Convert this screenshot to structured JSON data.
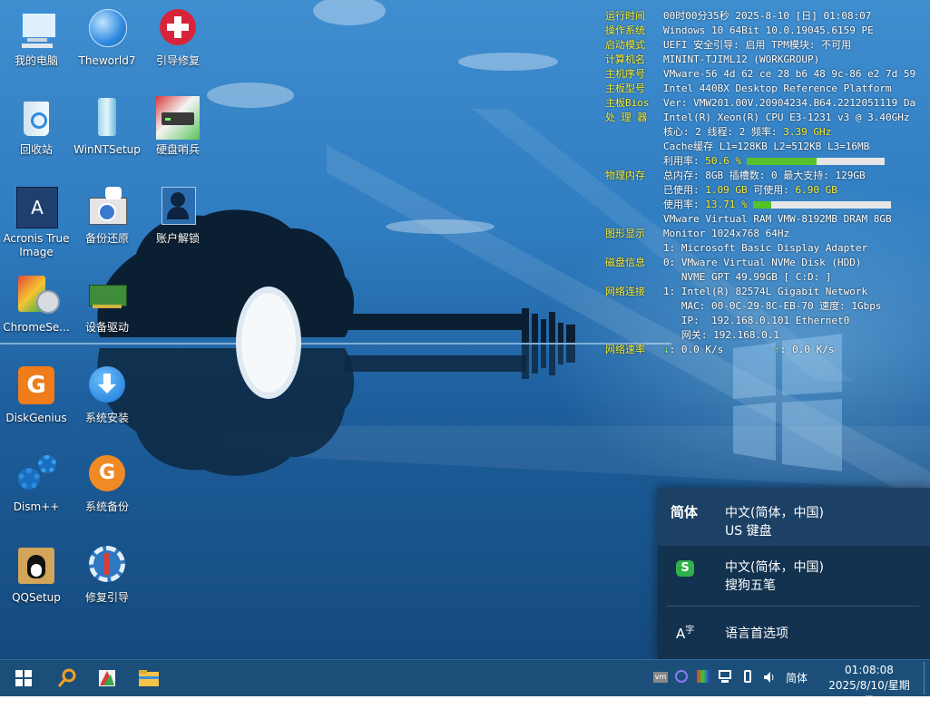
{
  "desktop_icons": [
    {
      "label": "我的电脑",
      "icon": "computer-icon"
    },
    {
      "label": "Theworld7",
      "icon": "globe-icon"
    },
    {
      "label": "引导修复",
      "icon": "plus-repair-icon"
    },
    {
      "label": "回收站",
      "icon": "recycle-bin-icon"
    },
    {
      "label": "WinNTSetup",
      "icon": "setup-icon"
    },
    {
      "label": "硬盘哨兵",
      "icon": "harddisk-icon"
    },
    {
      "label": "Acronis True Image",
      "icon": "acronis-icon"
    },
    {
      "label": "备份还原",
      "icon": "backup-icon"
    },
    {
      "label": "账户解锁",
      "icon": "account-icon"
    },
    {
      "label": "ChromeSe...",
      "icon": "chrome-setup-icon"
    },
    {
      "label": "设备驱动",
      "icon": "device-driver-icon"
    },
    {
      "label": "DiskGenius",
      "icon": "diskgenius-icon"
    },
    {
      "label": "系统安装",
      "icon": "install-icon"
    },
    {
      "label": "Dism++",
      "icon": "gears-icon"
    },
    {
      "label": "系统备份",
      "icon": "g-backup-icon"
    },
    {
      "label": "QQSetup",
      "icon": "qq-icon"
    },
    {
      "label": "修复引导",
      "icon": "wrench-icon"
    }
  ],
  "sysinfo": {
    "run_time": {
      "key": "运行时间",
      "value": "00时00分35秒 2025-8-10 [日] 01:08:07"
    },
    "os": {
      "key": "操作系统",
      "value": "Windows 10 64Bit 10.0.19045.6159 PE"
    },
    "boot": {
      "key": "启动模式",
      "value": "UEFI   安全引导: 启用   TPM模块: 不可用"
    },
    "host": {
      "key": "计算机名",
      "value": "MININT-TJIML12 (WORKGROUP)"
    },
    "serial": {
      "key": "主机序号",
      "value": "VMware-56 4d 62 ce 28 b6 48 9c-86 e2 7d 59"
    },
    "board": {
      "key": "主板型号",
      "value": "Intel 440BX Desktop Reference Platform"
    },
    "bios": {
      "key": "主板Bios",
      "value": "Ver: VMW201.00V.20904234.B64.2212051119 Da"
    },
    "cpu": {
      "key": "处 理 器",
      "value": "Intel(R) Xeon(R) CPU E3-1231 v3 @ 3.40GHz"
    },
    "cores": {
      "value": "核心: 2  线程: 2        频率: ",
      "freq": "3.39 GHz"
    },
    "cache": {
      "value": "Cache缓存 L1=128KB  L2=512KB  L3=16MB"
    },
    "cpu_use": {
      "label": "利用率: ",
      "value": "50.6 %",
      "fraction": 0.506
    },
    "mem": {
      "key": "物理内存",
      "value": "总内存: 8GB  插槽数: 0  最大支持: 129GB"
    },
    "mem_used": {
      "label": "已使用: ",
      "used": "1.09 GB",
      "avail_label": "      可使用: ",
      "avail": "6.90 GB"
    },
    "mem_use": {
      "label": "使用率: ",
      "value": "13.71 %",
      "fraction": 0.137
    },
    "mem_module": {
      "value": "VMware Virtual RAM VMW-8192MB DRAM 8GB"
    },
    "gpu": {
      "key": "图形显示",
      "value": "Monitor 1024x768 64Hz"
    },
    "gpu_adapter": {
      "value": "1: Microsoft Basic Display Adapter"
    },
    "disk": {
      "key": "磁盘信息",
      "value": "0: VMware Virtual NVMe Disk (HDD)"
    },
    "disk_detail": {
      "value": "   NVME GPT 49.99GB [ C:D: ]"
    },
    "net": {
      "key": "网络连接",
      "value": "1: Intel(R) 82574L Gigabit Network"
    },
    "mac": {
      "value": "   MAC: 00-0C-29-8C-EB-70 速度: 1Gbps"
    },
    "ip": {
      "value": "   IP:  192.168.0.101 Ethernet0"
    },
    "gateway": {
      "value": "   网关: 192.168.0.1"
    },
    "speed": {
      "key": "网络速率",
      "down": "↓: 0.0 K/s",
      "up": "↑: 0.0 K/s"
    }
  },
  "language_flyout": {
    "items": [
      {
        "code": "简体",
        "line1": "中文(简体，中国)",
        "line2": "US 键盘",
        "selected": true
      },
      {
        "code": "S",
        "line1": "中文(简体，中国)",
        "line2": "搜狗五笔",
        "selected": false
      }
    ],
    "prefs_label": "语言首选项",
    "prefs_icon": "language-prefs-icon"
  },
  "taskbar": {
    "start": "windows-start-icon",
    "pinned": [
      "search-icon",
      "tool-icon",
      "file-explorer-icon"
    ],
    "tray": [
      "vmware-icon",
      "sogou-icon",
      "color-icon",
      "network-icon",
      "usb-icon",
      "volume-icon"
    ],
    "ime_label": "简体",
    "time": "01:08:08",
    "date": "2025/8/10/星期日"
  },
  "colors": {
    "label_key": "#f8ee33",
    "highlight": "#7cf06a",
    "taskbar": "#1b4f7a",
    "flyout": "#12324f"
  }
}
